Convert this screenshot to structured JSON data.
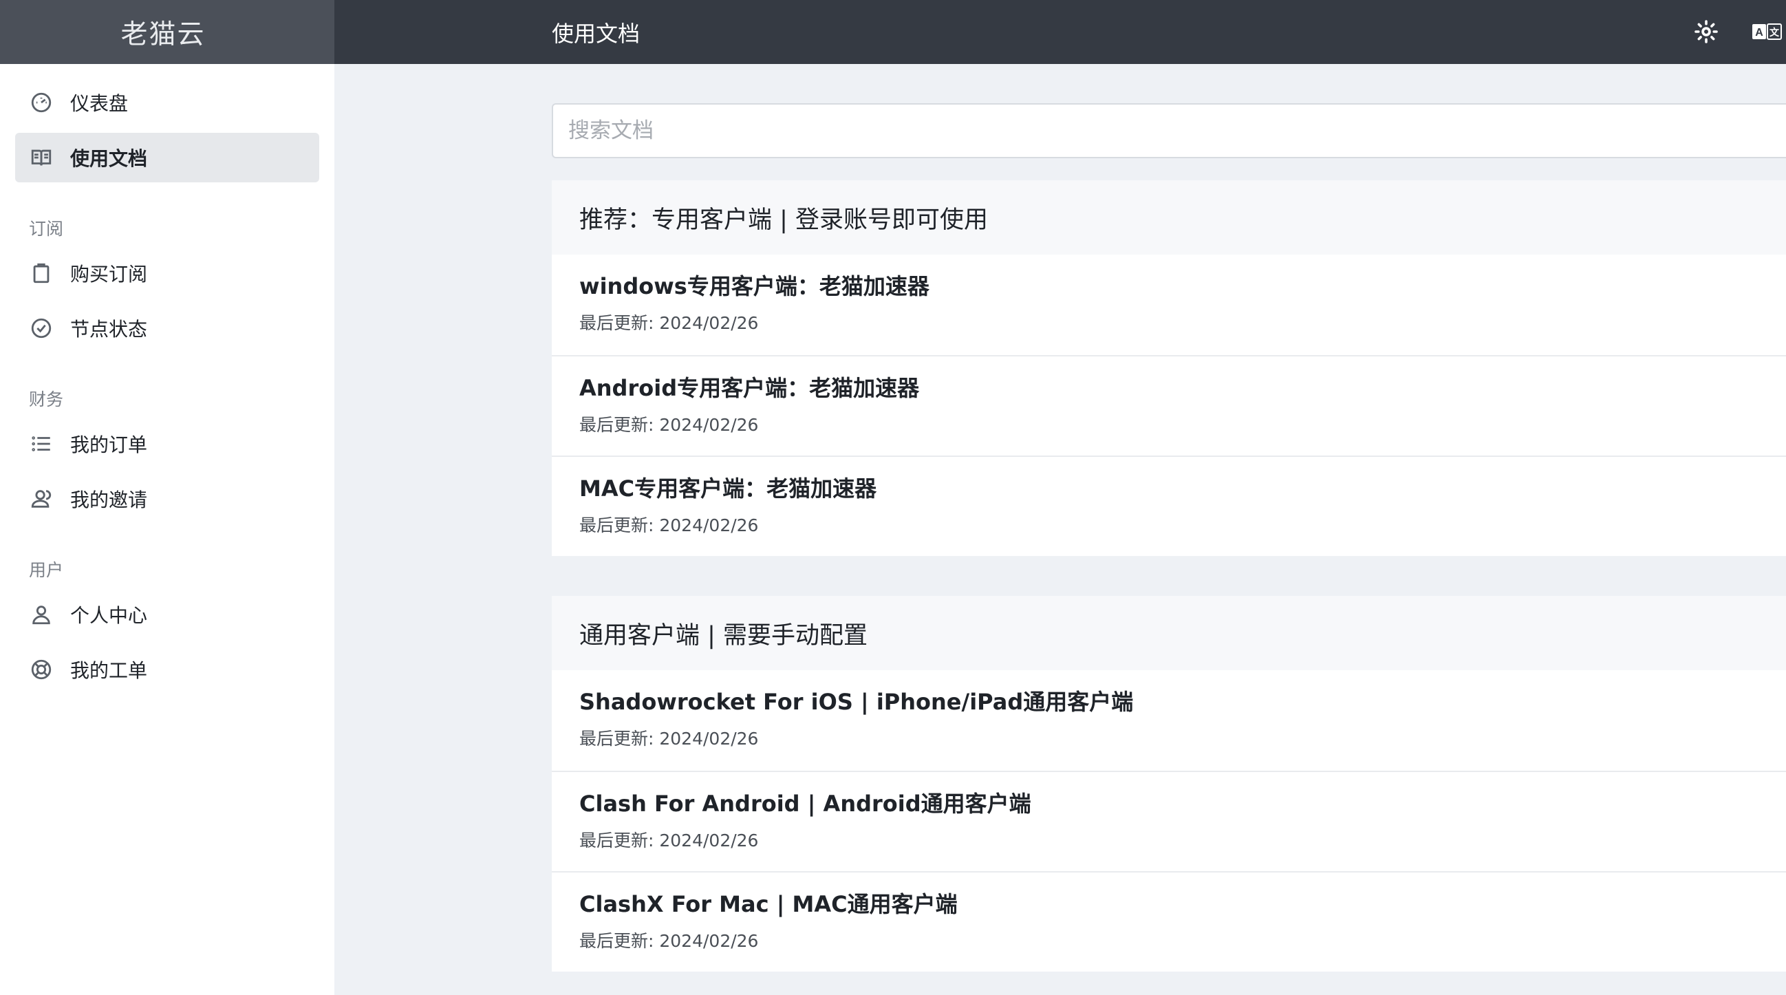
{
  "brand": "老猫云",
  "header": {
    "title": "使用文档",
    "theme_icon": "sun-icon",
    "lang_icon": "translate-icon"
  },
  "sidebar": {
    "items": [
      {
        "label": "仪表盘",
        "icon": "dashboard-icon"
      },
      {
        "label": "使用文档",
        "icon": "book-icon",
        "active": true
      }
    ],
    "groups": [
      {
        "title": "订阅",
        "items": [
          {
            "label": "购买订阅",
            "icon": "clipboard-icon"
          },
          {
            "label": "节点状态",
            "icon": "check-circle-icon"
          }
        ]
      },
      {
        "title": "财务",
        "items": [
          {
            "label": "我的订单",
            "icon": "list-icon"
          },
          {
            "label": "我的邀请",
            "icon": "users-icon"
          }
        ]
      },
      {
        "title": "用户",
        "items": [
          {
            "label": "个人中心",
            "icon": "user-icon"
          },
          {
            "label": "我的工单",
            "icon": "lifebuoy-icon"
          }
        ]
      }
    ]
  },
  "search": {
    "placeholder": "搜索文档",
    "value": ""
  },
  "sections": [
    {
      "title": "推荐：专用客户端 | 登录账号即可使用",
      "docs": [
        {
          "title": "windows专用客户端：老猫加速器",
          "updated": "最后更新: 2024/02/26"
        },
        {
          "title": "Android专用客户端：老猫加速器",
          "updated": "最后更新: 2024/02/26"
        },
        {
          "title": "MAC专用客户端：老猫加速器",
          "updated": "最后更新: 2024/02/26"
        }
      ]
    },
    {
      "title": "通用客户端 | 需要手动配置",
      "docs": [
        {
          "title": "Shadowrocket For iOS | iPhone/iPad通用客户端",
          "updated": "最后更新: 2024/02/26"
        },
        {
          "title": "Clash For Android | Android通用客户端",
          "updated": "最后更新: 2024/02/26"
        },
        {
          "title": "ClashX For Mac | MAC通用客户端",
          "updated": "最后更新: 2024/02/26"
        }
      ]
    }
  ]
}
